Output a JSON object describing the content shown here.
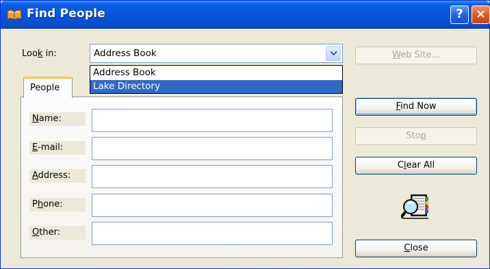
{
  "window": {
    "title": "Find People"
  },
  "titlebar": {
    "help_label": "?",
    "close_label": "×"
  },
  "look_in": {
    "label_prefix": "Loo",
    "label_accel": "k",
    "label_suffix": " in:",
    "selected": "Address Book",
    "options": [
      "Address Book",
      "Lake Directory"
    ],
    "highlighted_index": 1
  },
  "tabs": [
    {
      "label": "People"
    }
  ],
  "fields": [
    {
      "accel": "N",
      "rest": "ame:",
      "value": ""
    },
    {
      "accel": "E",
      "rest": "-mail:",
      "value": ""
    },
    {
      "accel": "A",
      "rest": "ddress:",
      "value": ""
    },
    {
      "pre": "P",
      "accel": "h",
      "rest": "one:",
      "value": ""
    },
    {
      "accel": "O",
      "rest": "ther:",
      "value": ""
    }
  ],
  "buttons": {
    "web_site": {
      "accel": "W",
      "rest": "eb Site...",
      "enabled": false
    },
    "find_now": {
      "accel": "F",
      "rest": "ind Now",
      "enabled": true
    },
    "stop": {
      "pre": "Sto",
      "accel": "p",
      "enabled": false
    },
    "clear_all": {
      "pre": "C",
      "accel": "l",
      "rest": "ear All",
      "enabled": true
    },
    "close": {
      "accel": "C",
      "rest": "lose",
      "enabled": true
    }
  },
  "icons": {
    "title": "address-book-icon",
    "search": "find-people-book-icon"
  },
  "colors": {
    "titlebar": "#0753dc",
    "selection": "#316ac5",
    "dialog_bg": "#ece9d8",
    "tab_accent": "#ffc83c"
  }
}
